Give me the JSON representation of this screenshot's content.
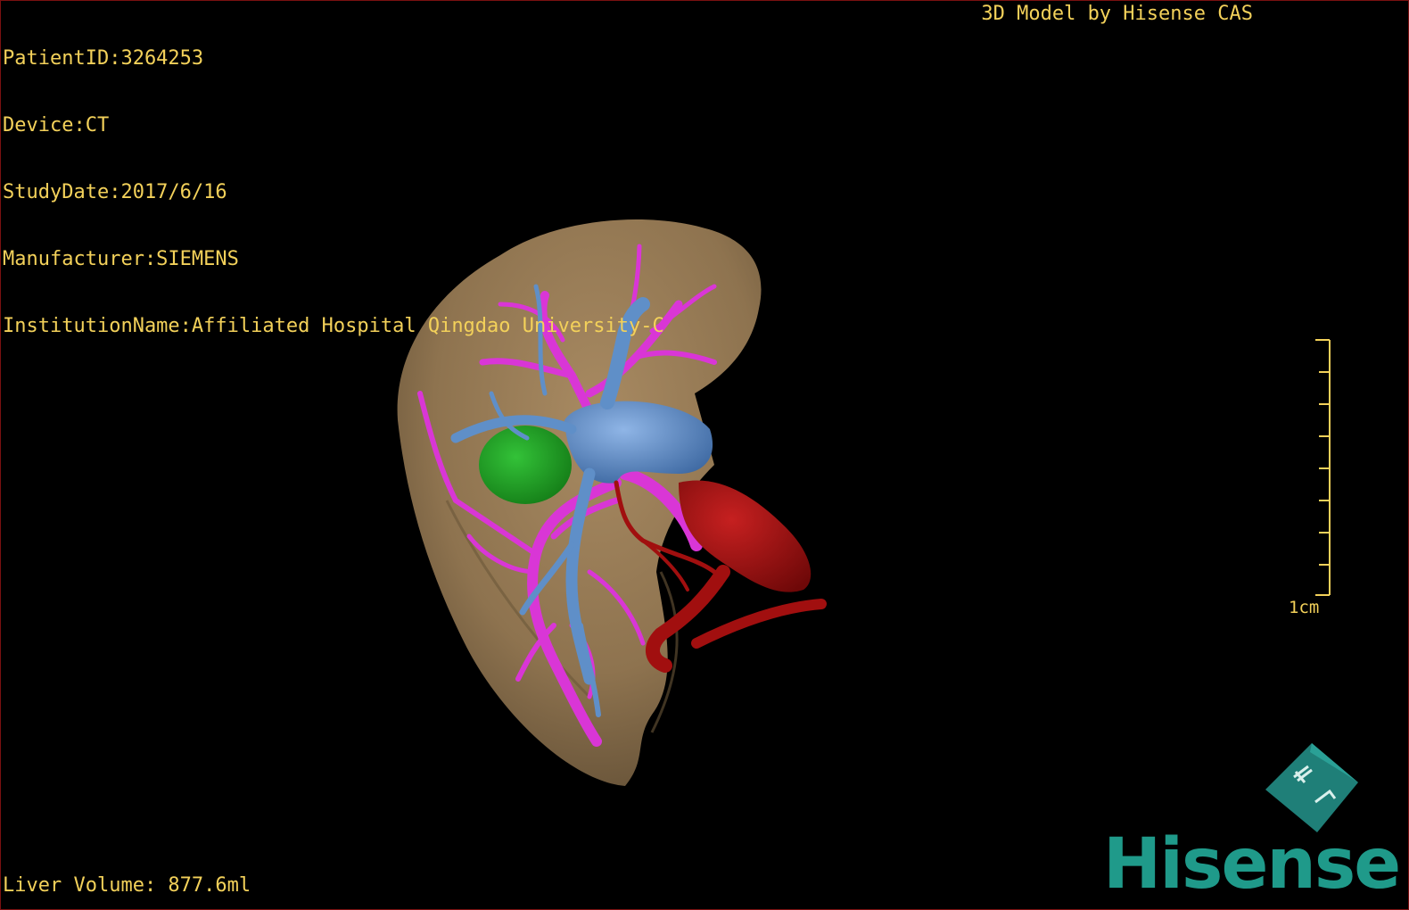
{
  "overlay": {
    "patient_id": "PatientID:3264253",
    "device": "Device:CT",
    "study_date": "StudyDate:2017/6/16",
    "manufacturer": "Manufacturer:SIEMENS",
    "institution": "InstitutionName:Affiliated Hospital Qingdao University-C",
    "model_credit": "3D Model by Hisense CAS",
    "liver_volume": "Liver Volume: 877.6ml"
  },
  "scale": {
    "label": "1cm"
  },
  "brand": {
    "name": "Hisense",
    "logo_icon": "hisense-cas-cube-icon"
  },
  "colors": {
    "overlay_text": "#f3d15a",
    "liver": "#8e734f",
    "portal_vein": "#d936d6",
    "hepatic_vein": "#5f8fc8",
    "artery": "#a10f0f",
    "gallbladder": "#1f9a22",
    "brand": "#1f9a8a",
    "background": "#000000"
  }
}
